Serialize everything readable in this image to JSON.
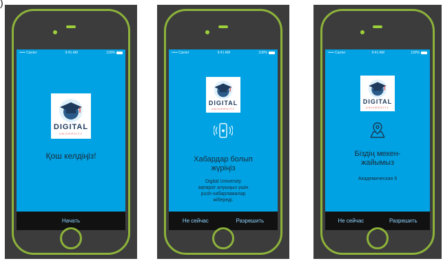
{
  "corner_mark": ")",
  "colors": {
    "frame": "#8db33a",
    "screen": "#00a2e3",
    "bar": "#111111",
    "bar_text": "#8fd4ff"
  },
  "logo": {
    "line1": "DIGITAL",
    "line2": "UNIVERSITY",
    "icon": "graduation-cap-icon"
  },
  "screen1": {
    "status": {
      "carrier": "••••• Carrier",
      "time": "9:41 AM",
      "battery": "100%"
    },
    "title": "Қош келдіңіз!",
    "bar_button": "Начать"
  },
  "screen2": {
    "status": {
      "carrier": "••••• Carrier",
      "time": "9:41 AM",
      "battery": "100%"
    },
    "icon": "phone-notification-icon",
    "title_line1": "Хабардар болып",
    "title_line2": "жүріңіз",
    "desc_line1": "Digital University",
    "desc_line2": "ақпарат алуыңыз үшін",
    "desc_line3": "push-хабарламалар",
    "desc_line4": "жібереді.",
    "left_button": "Не сейчас",
    "right_button": "Разрешить"
  },
  "screen3": {
    "status": {
      "carrier": "••••• Carrier",
      "time": "9:41 AM",
      "battery": "100%"
    },
    "icon": "map-pin-icon",
    "title_line1": "Біздің мекен-",
    "title_line2": "жайымыз",
    "address": "Академическая 9",
    "left_button": "Не сейчас",
    "right_button": "Разрешить"
  }
}
